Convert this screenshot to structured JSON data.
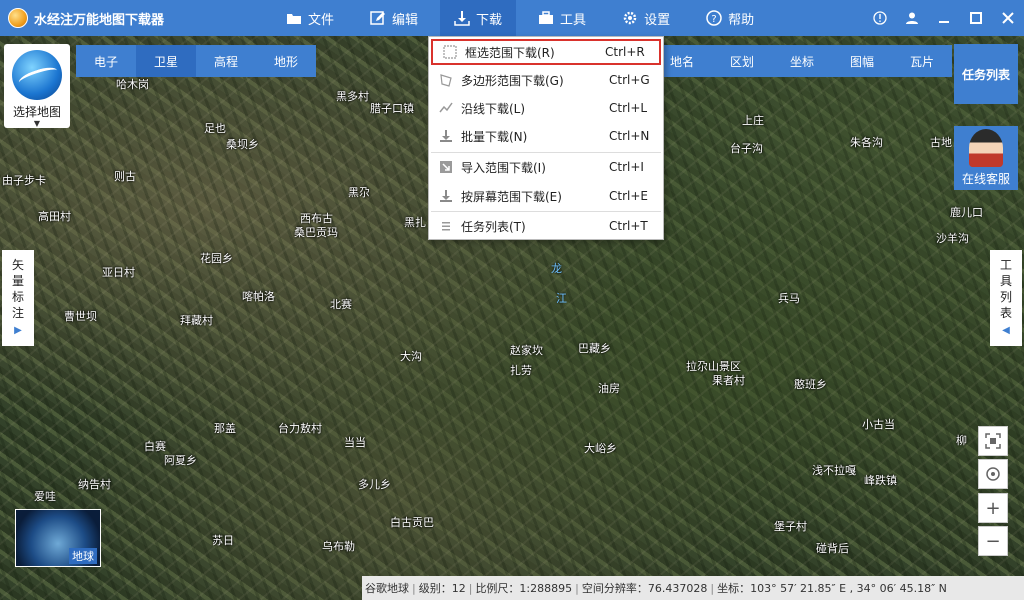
{
  "app": {
    "title": "水经注万能地图下载器"
  },
  "menu": {
    "items": [
      {
        "label": "文件",
        "icon": "folder-icon"
      },
      {
        "label": "编辑",
        "icon": "edit-icon"
      },
      {
        "label": "下载",
        "icon": "download-icon",
        "active": true
      },
      {
        "label": "工具",
        "icon": "toolbox-icon"
      },
      {
        "label": "设置",
        "icon": "gear-icon"
      },
      {
        "label": "帮助",
        "icon": "help-icon"
      }
    ]
  },
  "map_switch": {
    "label": "选择地图"
  },
  "map_types": [
    "电子",
    "卫星",
    "高程",
    "地形"
  ],
  "layer_tabs": [
    "地名",
    "区划",
    "坐标",
    "图幅",
    "瓦片"
  ],
  "buttons": {
    "task_list": "任务列表",
    "online_service": "在线客服",
    "vector_label": [
      "矢",
      "量",
      "标",
      "注"
    ],
    "tool_list": [
      "工",
      "具",
      "列",
      "表"
    ]
  },
  "mini_globe": {
    "label": "地球"
  },
  "download_menu": {
    "items": [
      {
        "label": "框选范围下载(R)",
        "shortcut": "Ctrl+R",
        "highlight": true
      },
      {
        "label": "多边形范围下载(G)",
        "shortcut": "Ctrl+G"
      },
      {
        "label": "沿线下载(L)",
        "shortcut": "Ctrl+L"
      },
      {
        "label": "批量下载(N)",
        "shortcut": "Ctrl+N"
      },
      {
        "label": "导入范围下载(I)",
        "shortcut": "Ctrl+I"
      },
      {
        "label": "按屏幕范围下载(E)",
        "shortcut": "Ctrl+E"
      },
      {
        "label": "任务列表(T)",
        "shortcut": "Ctrl+T"
      }
    ]
  },
  "status": {
    "source": "谷歌地球",
    "level": "级别：12",
    "scale": "比例尺：1:288895",
    "resolution": "空间分辨率：76.437028",
    "coords": "坐标：103° 57′ 21.85″ E , 34° 06′ 45.18″ N"
  },
  "places": [
    "哈木岗",
    "黑多村",
    "腊子口镇",
    "足也",
    "桑坝乡",
    "则古",
    "由子步卡",
    "高田村",
    "黑尕",
    "西布古",
    "桑巴贡玛",
    "黑扎",
    "亚日村",
    "花园乡",
    "喀帕洛",
    "北赛",
    "曹世坝",
    "拜藏村",
    "大沟",
    "赵家坎",
    "扎劳",
    "巴藏乡",
    "油房",
    "拉尕山景区",
    "果者村",
    "憨班乡",
    "那盖",
    "台力敖村",
    "当当",
    "白赛",
    "阿夏乡",
    "大峪乡",
    "小古当",
    "浅不拉嘎",
    "纳告村",
    "多儿乡",
    "峰跌镇",
    "爱哇",
    "白古贡巴",
    "堡子村",
    "苏日",
    "乌布勒",
    "碰背后",
    "上庄",
    "台子沟",
    "朱各沟",
    "古地",
    "鹿儿口",
    "沙羊沟",
    "兵马",
    "柳"
  ],
  "rivers": [
    "龙",
    "江"
  ]
}
